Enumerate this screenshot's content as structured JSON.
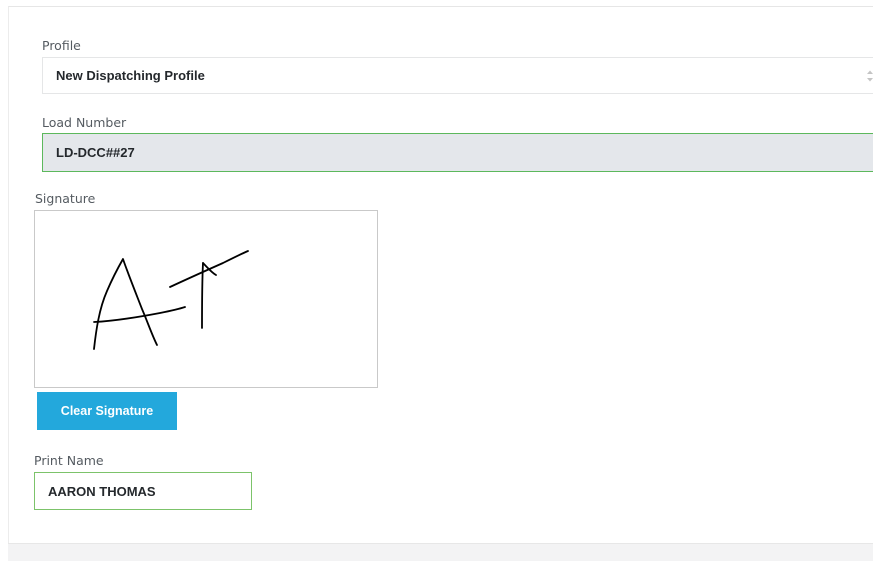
{
  "profile": {
    "label": "Profile",
    "selected": "New Dispatching Profile"
  },
  "load_number": {
    "label": "Load Number",
    "value": "LD-DCC##27"
  },
  "signature": {
    "label": "Signature",
    "clear_label": "Clear Signature"
  },
  "print_name": {
    "label": "Print Name",
    "value": "AARON THOMAS"
  },
  "colors": {
    "button": "#23a8dc",
    "valid_border": "#5cb85c",
    "readonly_bg": "#e4e7eb"
  }
}
